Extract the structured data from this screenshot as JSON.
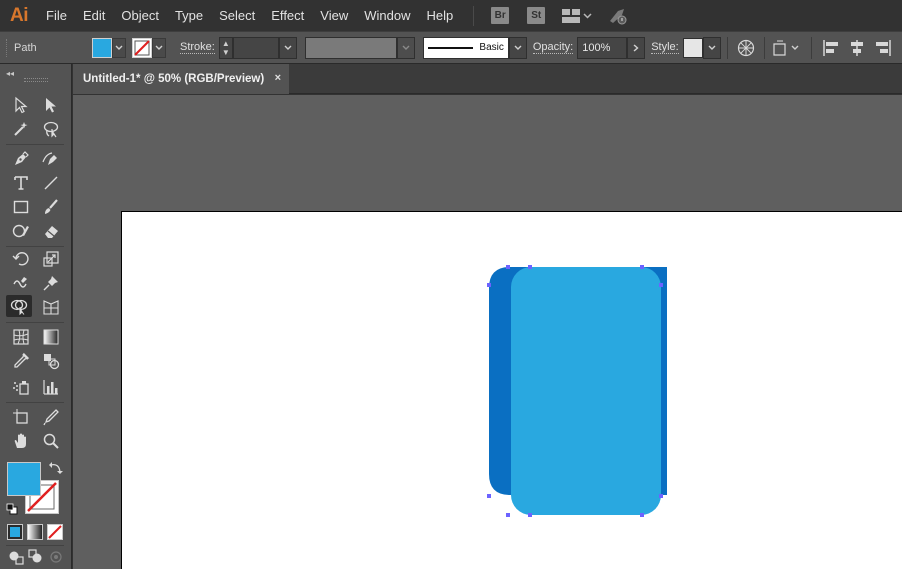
{
  "app": {
    "logo": "Ai"
  },
  "menu": [
    "File",
    "Edit",
    "Object",
    "Type",
    "Select",
    "Effect",
    "View",
    "Window",
    "Help"
  ],
  "menubar_apps": {
    "bridge": "Br",
    "stock": "St"
  },
  "control_bar": {
    "selection_type": "Path",
    "fill_color": "#29a8e0",
    "stroke_label": "Stroke:",
    "stroke_weight": "",
    "brush_label": "Basic",
    "opacity_label": "Opacity:",
    "opacity_value": "100%",
    "style_label": "Style:"
  },
  "document": {
    "tab_title": "Untitled-1* @ 50% (RGB/Preview)",
    "close_glyph": "×"
  },
  "toolbox": {
    "collapse_glyph": "◂◂",
    "fill_color": "#29a8e0",
    "stroke_color": "none"
  },
  "artwork": {
    "back_color": "#0a6fc2",
    "front_color": "#29a8e0",
    "anchor_color": "#6c63ff"
  }
}
